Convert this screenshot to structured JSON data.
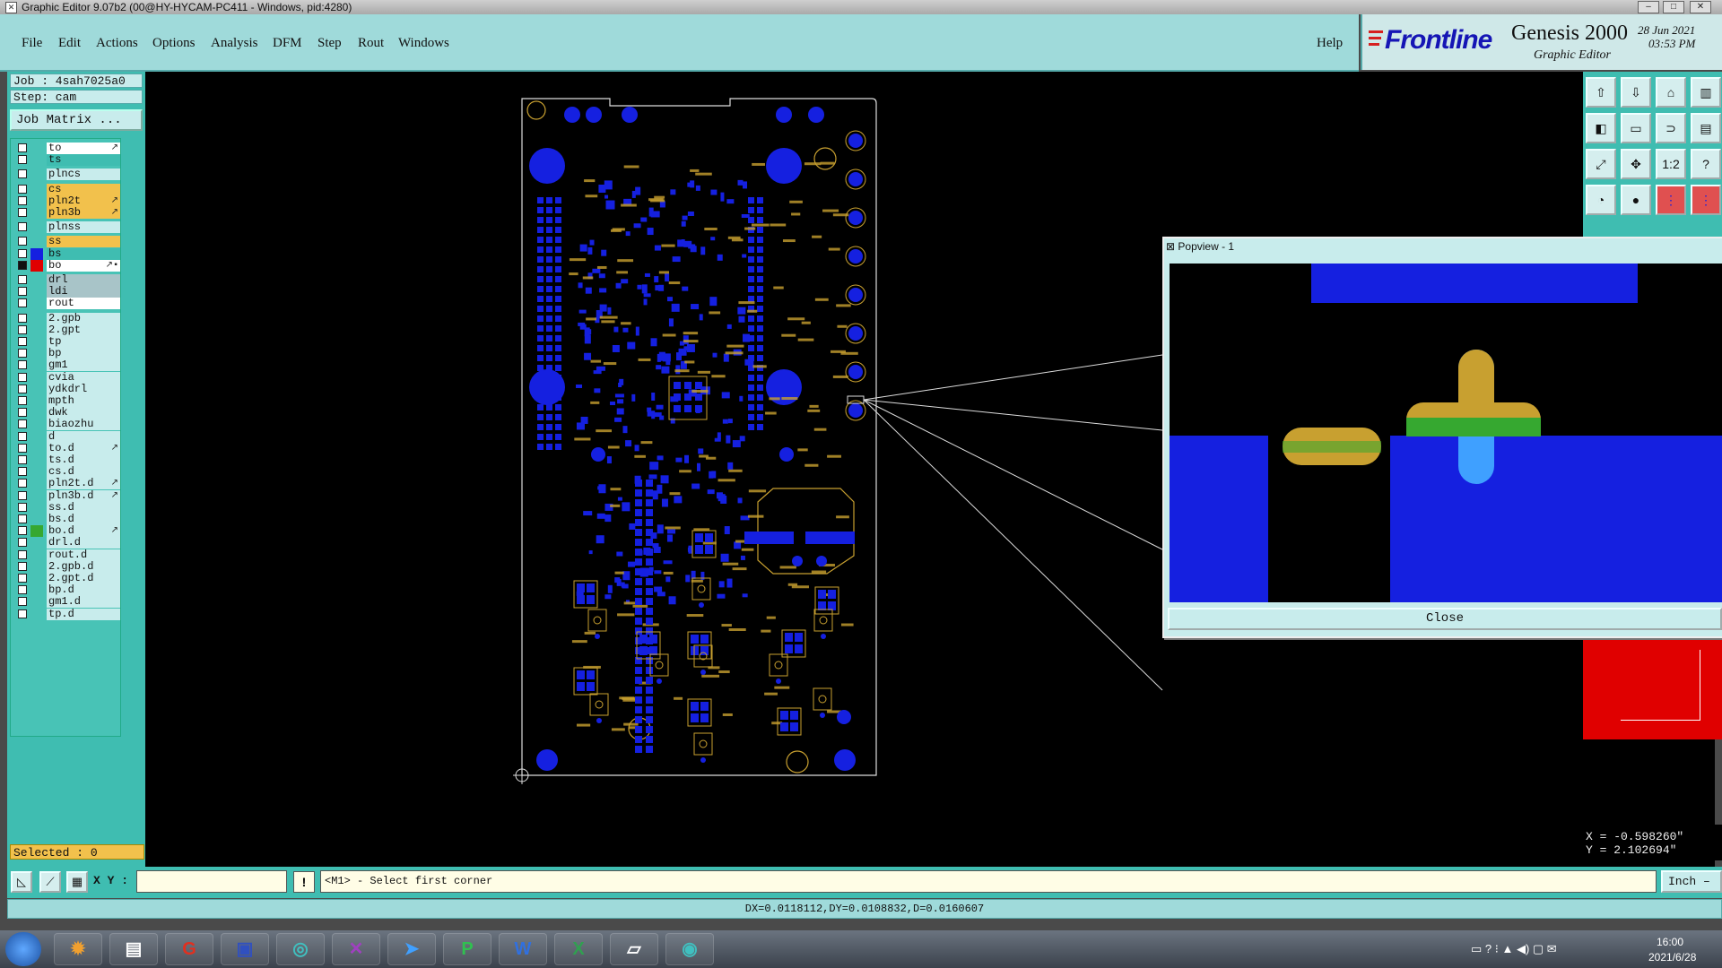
{
  "window": {
    "title": "Graphic Editor 9.07b2 (00@HY-HYCAM-PC411 - Windows, pid:4280)"
  },
  "menu": [
    "File",
    "Edit",
    "Actions",
    "Options",
    "Analysis",
    "DFM",
    "Step",
    "Rout",
    "Windows"
  ],
  "help": "Help",
  "logo": {
    "brand": "Frontline",
    "product": "Genesis 2000",
    "subtitle": "Graphic Editor",
    "date": "28 Jun 2021",
    "time": "03:53 PM"
  },
  "job": {
    "job_label": "Job : 4sah7025a0",
    "step_label": "Step: cam",
    "matrix_button": "Job Matrix ..."
  },
  "layers": [
    {
      "name": "to",
      "color": "#ffffff",
      "mark": "↗"
    },
    {
      "name": "ts",
      "color": "#3fbdb1"
    },
    {
      "name": "plncs",
      "color": "#c8ecec"
    },
    {
      "name": "cs",
      "color": "#f2c14c"
    },
    {
      "name": "pln2t",
      "color": "#f2c14c",
      "mark": "↗"
    },
    {
      "name": "pln3b",
      "color": "#f2c14c",
      "mark": "↗"
    },
    {
      "name": "plnss",
      "color": "#c8ecec"
    },
    {
      "name": "ss",
      "color": "#f2c14c"
    },
    {
      "name": "bs",
      "color": "#3fbdb1",
      "swatch": "#1520e0"
    },
    {
      "name": "bo",
      "color": "#ffffff",
      "swatch": "#e00000",
      "mark": "↗▪",
      "active": true
    },
    {
      "name": "drl",
      "color": "#a8c4c8"
    },
    {
      "name": "ldi",
      "color": "#a8c4c8"
    },
    {
      "name": "rout",
      "color": "#ffffff"
    },
    {
      "name": "2.gpb",
      "color": "#c8ecec"
    },
    {
      "name": "2.gpt",
      "color": "#c8ecec"
    },
    {
      "name": "tp",
      "color": "#c8ecec"
    },
    {
      "name": "bp",
      "color": "#c8ecec"
    },
    {
      "name": "gm1",
      "color": "#c8ecec"
    },
    {
      "name": "cvia",
      "color": "#c8ecec"
    },
    {
      "name": "ydkdrl",
      "color": "#c8ecec"
    },
    {
      "name": "mpth",
      "color": "#c8ecec"
    },
    {
      "name": "dwk",
      "color": "#c8ecec"
    },
    {
      "name": "biaozhu",
      "color": "#c8ecec"
    },
    {
      "name": "d",
      "color": "#c8ecec"
    },
    {
      "name": "to.d",
      "color": "#c8ecec",
      "mark": "↗"
    },
    {
      "name": "ts.d",
      "color": "#c8ecec"
    },
    {
      "name": "cs.d",
      "color": "#c8ecec"
    },
    {
      "name": "pln2t.d",
      "color": "#c8ecec",
      "mark": "↗"
    },
    {
      "name": "pln3b.d",
      "color": "#c8ecec",
      "mark": "↗"
    },
    {
      "name": "ss.d",
      "color": "#c8ecec"
    },
    {
      "name": "bs.d",
      "color": "#c8ecec"
    },
    {
      "name": "bo.d",
      "color": "#c8ecec",
      "swatch": "#36a830",
      "mark": "↗"
    },
    {
      "name": "drl.d",
      "color": "#c8ecec"
    },
    {
      "name": "rout.d",
      "color": "#c8ecec"
    },
    {
      "name": "2.gpb.d",
      "color": "#c8ecec"
    },
    {
      "name": "2.gpt.d",
      "color": "#c8ecec"
    },
    {
      "name": "bp.d",
      "color": "#c8ecec"
    },
    {
      "name": "gm1.d",
      "color": "#c8ecec"
    },
    {
      "name": "tp.d",
      "color": "#c8ecec"
    }
  ],
  "selected": "Selected : 0",
  "popview": {
    "title": "Popview - 1",
    "close": "Close"
  },
  "coords": {
    "x": "X = -0.598260\"",
    "y": "Y = 2.102694\""
  },
  "command": {
    "xy_label": "X Y :",
    "prompt": "<M1> - Select first corner",
    "units": "Inch –"
  },
  "status": "DX=0.0118112,DY=0.0108832,D=0.0160607",
  "taskbar": {
    "time": "16:00",
    "date": "2021/6/28"
  },
  "colors": {
    "pad": "#1520e0",
    "silk": "#c8a030",
    "accent": "#3fbdb1"
  }
}
